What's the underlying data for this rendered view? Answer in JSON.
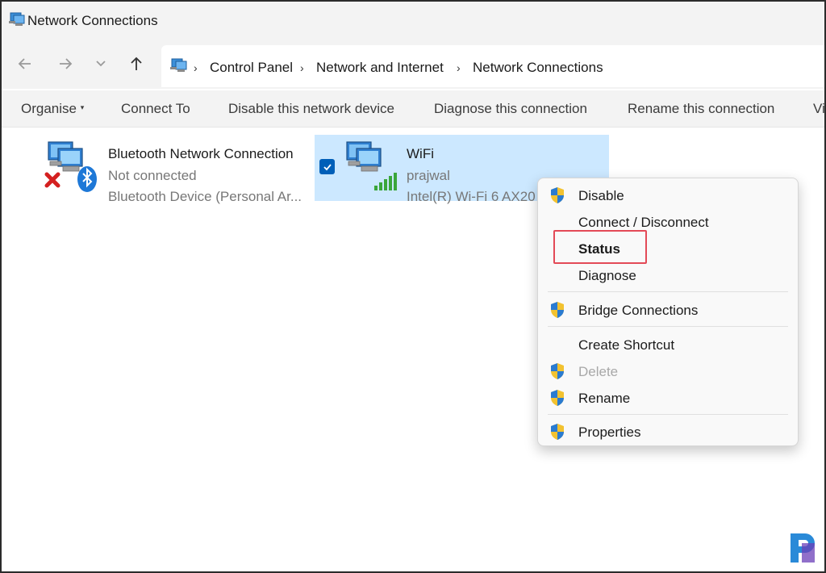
{
  "window": {
    "title": "Network Connections"
  },
  "breadcrumb": [
    "Control Panel",
    "Network and Internet",
    "Network Connections"
  ],
  "commands": [
    "Organise",
    "Connect To",
    "Disable this network device",
    "Diagnose this connection",
    "Rename this connection",
    "Vi"
  ],
  "connections": [
    {
      "name": "Bluetooth Network Connection",
      "status": "Not connected",
      "device": "Bluetooth Device (Personal Ar...",
      "selected": false
    },
    {
      "name": "WiFi",
      "status": "prajwal",
      "device": "Intel(R) Wi-Fi 6 AX20",
      "selected": true
    }
  ],
  "context_menu": {
    "items": [
      {
        "label": "Disable",
        "shield": true,
        "disabled": false,
        "bold": false
      },
      {
        "label": "Connect / Disconnect",
        "shield": false,
        "disabled": false,
        "bold": false
      },
      {
        "label": "Status",
        "shield": false,
        "disabled": false,
        "bold": true,
        "highlighted": true
      },
      {
        "label": "Diagnose",
        "shield": false,
        "disabled": false,
        "bold": false
      },
      {
        "label": "Bridge Connections",
        "shield": true,
        "disabled": false,
        "bold": false
      },
      {
        "label": "Create Shortcut",
        "shield": false,
        "disabled": false,
        "bold": false
      },
      {
        "label": "Delete",
        "shield": true,
        "disabled": true,
        "bold": false
      },
      {
        "label": "Rename",
        "shield": true,
        "disabled": false,
        "bold": false
      },
      {
        "label": "Properties",
        "shield": true,
        "disabled": false,
        "bold": false
      }
    ]
  },
  "colors": {
    "selection": "#cce8ff",
    "highlight_box": "#e34a57",
    "accent": "#005fb8"
  }
}
